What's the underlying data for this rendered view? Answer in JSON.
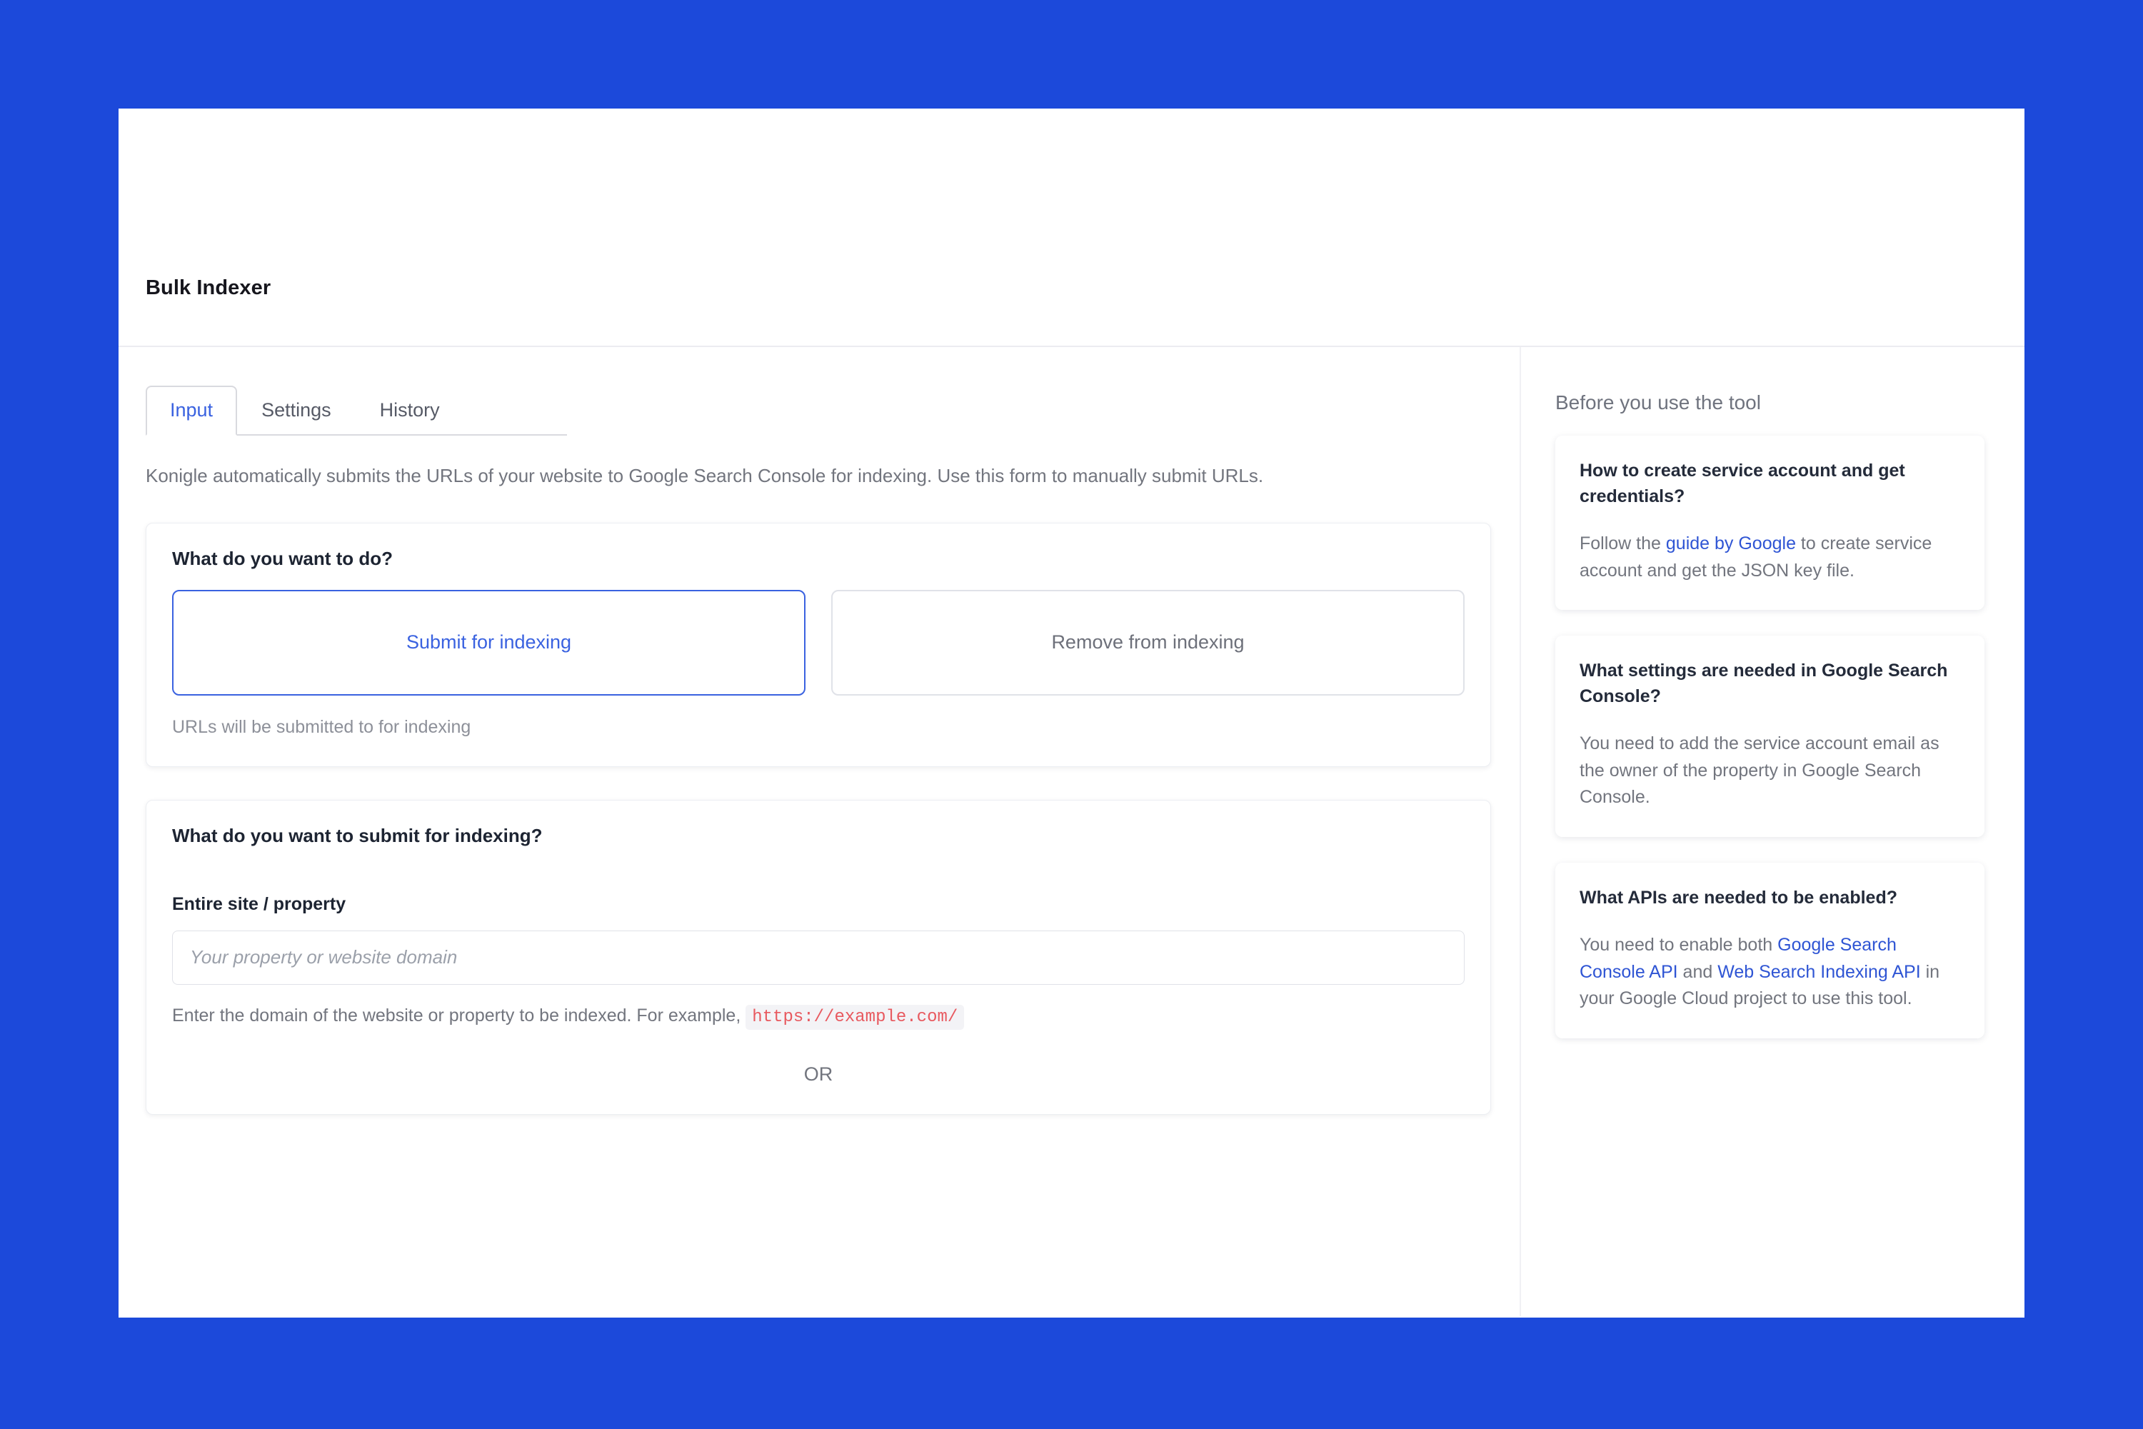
{
  "app": {
    "title": "Bulk Indexer"
  },
  "tabs": [
    {
      "label": "Input",
      "active": true
    },
    {
      "label": "Settings",
      "active": false
    },
    {
      "label": "History",
      "active": false
    }
  ],
  "main": {
    "intro": "Konigle automatically submits the URLs of your website to Google Search Console for indexing. Use this form to manually submit URLs.",
    "action_section": {
      "label": "What do you want to do?",
      "options": [
        {
          "label": "Submit for indexing",
          "selected": true
        },
        {
          "label": "Remove from indexing",
          "selected": false
        }
      ],
      "hint": "URLs will be submitted to for indexing"
    },
    "submit_section": {
      "heading": "What do you want to submit for indexing?",
      "field_label": "Entire site / property",
      "input_value": "",
      "input_placeholder": "Your property or website domain",
      "help_prefix": "Enter the domain of the website or property to be indexed. For example,",
      "help_code": "https://example.com/",
      "or_label": "OR"
    }
  },
  "sidebar": {
    "title": "Before you use the tool",
    "cards": [
      {
        "title": "How to create service account and get credentials?",
        "body_1": "Follow the ",
        "link_1": "guide by Google",
        "body_2": " to create service account and get the JSON key file.",
        "link_2": "",
        "body_3": ""
      },
      {
        "title": "What settings are needed in Google Search Console?",
        "body_1": "You need to add the service account email as the owner of the property in Google Search Console.",
        "link_1": "",
        "body_2": "",
        "link_2": "",
        "body_3": ""
      },
      {
        "title": "What APIs are needed to be enabled?",
        "body_1": "You need to enable both ",
        "link_1": "Google Search Console API",
        "body_2": " and ",
        "link_2": "Web Search Indexing API",
        "body_3": " in your Google Cloud project to use this tool."
      }
    ]
  },
  "colors": {
    "page_background": "#1c49da",
    "accent": "#3a62e0",
    "link": "#2f55d4",
    "code_text": "#e8595f",
    "code_background": "#f3f3f6"
  }
}
